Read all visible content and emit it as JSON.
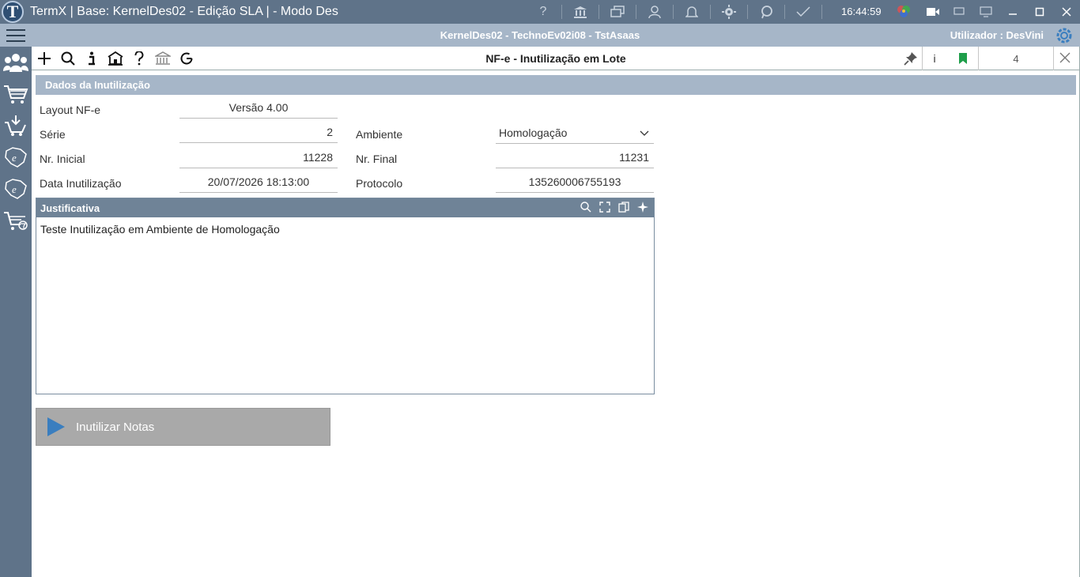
{
  "window": {
    "title": "TermX | Base: KernelDes02 - Edição SLA | - Modo Des",
    "logo_letter": "T",
    "clock": "16:44:59"
  },
  "context_bar": {
    "context": "KernelDes02 - TechnoEv02i08 - TstAsaas",
    "user_label": "Utilizador : DesVini"
  },
  "toolbar": {
    "form_title": "NF-e - Inutilização em Lote",
    "info_label": "i",
    "tab_count": "4"
  },
  "section": {
    "title": "Dados da Inutilização"
  },
  "form": {
    "layout_label": "Layout NF-e",
    "layout_value": "Versão 4.00",
    "serie_label": "Série",
    "serie_value": "2",
    "ambiente_label": "Ambiente",
    "ambiente_value": "Homologação",
    "nr_inicial_label": "Nr. Inicial",
    "nr_inicial_value": "11228",
    "nr_final_label": "Nr. Final",
    "nr_final_value": "11231",
    "data_label": "Data Inutilização",
    "data_value": "20/07/2026 18:13:00",
    "protocolo_label": "Protocolo",
    "protocolo_value": "135260006755193"
  },
  "justificativa": {
    "title": "Justificativa",
    "text": "Teste Inutilização em Ambiente de Homologação"
  },
  "action": {
    "label": "Inutilizar Notas"
  },
  "colors": {
    "titlebar": "#5f7389",
    "subbar": "#a6b6c8",
    "accent_green": "#1e9e4a",
    "play_blue": "#3a7ebf"
  }
}
